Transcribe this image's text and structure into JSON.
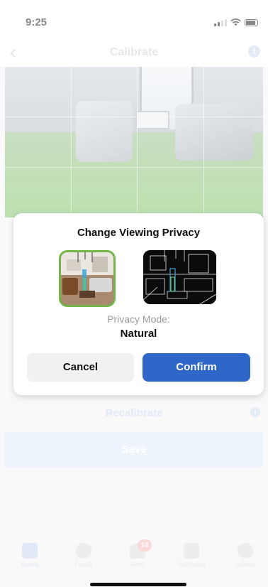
{
  "status_bar": {
    "time": "9:25"
  },
  "nav": {
    "back_icon": "chevron-left-icon",
    "title": "Calibrate",
    "info_icon": "i"
  },
  "camera": {
    "description_icon": "camera-feed"
  },
  "recalibrate": {
    "label": "Recalibrate",
    "info_icon": "i"
  },
  "save": {
    "label": "Save"
  },
  "modal": {
    "title": "Change Viewing Privacy",
    "privacy_label": "Privacy Mode:",
    "privacy_value": "Natural",
    "cancel_label": "Cancel",
    "confirm_label": "Confirm",
    "selected_option": "natural"
  },
  "tabs": [
    {
      "label": "Rooms",
      "icon": "rooms-icon",
      "active": true
    },
    {
      "label": "People",
      "icon": "people-icon",
      "active": false
    },
    {
      "label": "Alerts",
      "icon": "bell-icon",
      "active": false,
      "badge": "14"
    },
    {
      "label": "Dashboard",
      "icon": "chart-icon",
      "active": false
    },
    {
      "label": "Settings",
      "icon": "gear-icon",
      "active": false
    }
  ],
  "colors": {
    "accent": "#2e67c7",
    "selected_border": "#75b44b",
    "floor_overlay": "#6ec85a"
  }
}
